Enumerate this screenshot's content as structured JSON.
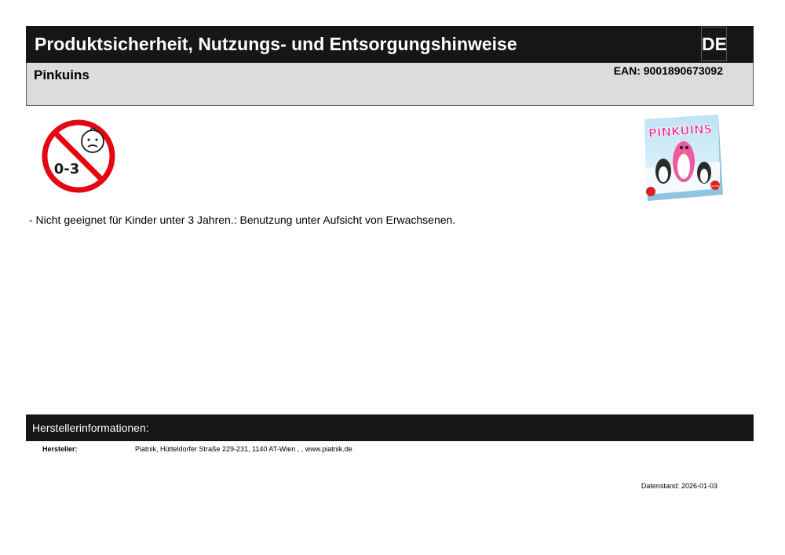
{
  "header": {
    "title": "Produktsicherheit, Nutzungs- und Entsorgungshinweise",
    "language": "DE"
  },
  "product": {
    "name": "Pinkuins",
    "ean": "EAN: 9001890673092"
  },
  "age_warning": {
    "icon": "age-0-3-prohibited-icon",
    "label": "0-3",
    "color": "#e30613"
  },
  "box_art": {
    "logo_text": "PINKUINS",
    "brand_text": "PIATNIK"
  },
  "notice": "- Nicht geeignet für Kinder unter 3 Jahren.: Benutzung unter Aufsicht von Erwachsenen.",
  "manufacturer": {
    "section_title": "Herstellerinformationen:",
    "label": "Hersteller:",
    "value": "Piatnik, Hütteldorfer Straße 229-231, 1140 AT-Wien , , www.piatnik.de"
  },
  "date_stamp": "Datenstand: 2026-01-03"
}
